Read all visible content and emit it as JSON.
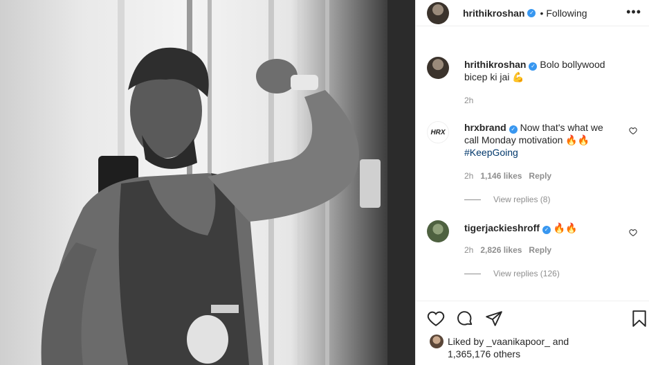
{
  "post": {
    "author": "hrithikroshan",
    "follow_status": "Following",
    "more_label": "•••"
  },
  "caption": {
    "user": "hrithikroshan",
    "text": "Bolo bollywood bicep ki jai 💪",
    "time": "2h"
  },
  "comments": [
    {
      "user": "hrxbrand",
      "avatar_text": "HRX",
      "text": "Now that's what we call Monday motivation 🔥🔥",
      "hashtag": "#KeepGoing",
      "time": "2h",
      "likes": "1,146 likes",
      "reply_label": "Reply",
      "view_replies": "View replies (8)"
    },
    {
      "user": "tigerjackieshroff",
      "text": "🔥🔥",
      "time": "2h",
      "likes": "2,826 likes",
      "reply_label": "Reply",
      "view_replies": "View replies (126)"
    }
  ],
  "footer": {
    "liked_by_prefix": "Liked by",
    "liked_by_user": "_vaanikapoor_",
    "and_label": "and",
    "others_count": "1,365,176 others"
  },
  "icons": {
    "like": "heart-icon",
    "comment": "comment-icon",
    "share": "paper-plane-icon",
    "save": "bookmark-icon",
    "verified": "verified-badge-icon",
    "more": "more-options-icon"
  },
  "colors": {
    "verified": "#3897f0",
    "meta_text": "#8e8e8e",
    "hashtag": "#00376b"
  }
}
